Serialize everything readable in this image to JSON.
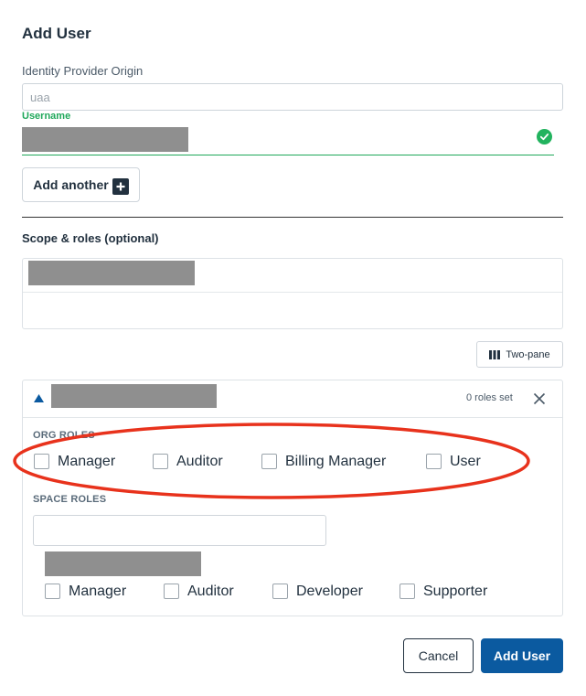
{
  "page": {
    "title": "Add User"
  },
  "identity_provider": {
    "label": "Identity Provider Origin",
    "placeholder": "uaa"
  },
  "username": {
    "label": "Username"
  },
  "buttons": {
    "add_another": "Add another",
    "two_pane": "Two-pane",
    "cancel": "Cancel",
    "add_user": "Add User"
  },
  "scope": {
    "title": "Scope & roles (optional)"
  },
  "org_panel": {
    "roles_count": "0 roles set",
    "org_roles_heading": "ORG ROLES",
    "org_roles": [
      "Manager",
      "Auditor",
      "Billing Manager",
      "User"
    ],
    "space_roles_heading": "SPACE ROLES",
    "space_roles": [
      "Manager",
      "Auditor",
      "Developer",
      "Supporter"
    ]
  },
  "colors": {
    "accent": "#0b5aa0",
    "success": "#22b35e",
    "annotation": "#e8321c"
  },
  "icons": {
    "valid": "check-circle-icon",
    "add": "plus-icon",
    "layout": "columns-icon",
    "collapse": "caret-up-icon",
    "remove": "close-icon"
  }
}
